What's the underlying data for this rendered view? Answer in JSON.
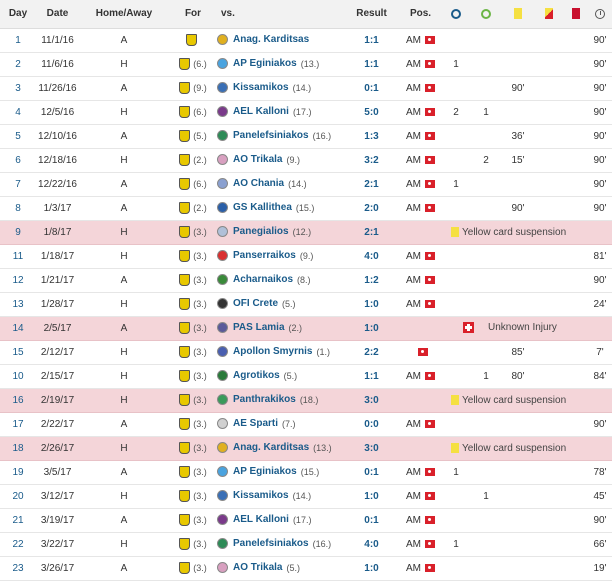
{
  "headers": {
    "day": "Day",
    "date": "Date",
    "home_away": "Home/Away",
    "for": "For",
    "vs": "vs.",
    "result": "Result",
    "pos": "Pos.",
    "goals_icon": "goals-icon",
    "assists_icon": "assists-icon",
    "yellow_icon": "yellow-card-icon",
    "yellowred_icon": "yellow-red-card-icon",
    "red_icon": "red-card-icon",
    "minutes_icon": "minutes-icon"
  },
  "colors": {
    "absent_row": "#f4d5d9",
    "link_blue": "#1a5b8a",
    "flag_red": "#d9202a",
    "card_yellow": "#f5e042"
  },
  "rows": [
    {
      "day": "1",
      "date": "11/1/16",
      "ha": "A",
      "for_pos": "",
      "opp": "Anag. Karditsas",
      "opp_pos": "",
      "result": "1:1",
      "pos": "AM",
      "goals": "",
      "assists": "",
      "yellow": "",
      "yellowred": "",
      "red": "",
      "mins": "90'",
      "crest": "#e0b020"
    },
    {
      "day": "2",
      "date": "11/6/16",
      "ha": "H",
      "for_pos": "(6.)",
      "opp": "AP Eginiakos",
      "opp_pos": "(13.)",
      "result": "1:1",
      "pos": "AM",
      "goals": "1",
      "assists": "",
      "yellow": "",
      "yellowred": "",
      "red": "",
      "mins": "90'",
      "crest": "#4aa3df"
    },
    {
      "day": "3",
      "date": "11/26/16",
      "ha": "A",
      "for_pos": "(9.)",
      "opp": "Kissamikos",
      "opp_pos": "(14.)",
      "result": "0:1",
      "pos": "AM",
      "goals": "",
      "assists": "",
      "yellow": "90'",
      "yellowred": "",
      "red": "",
      "mins": "90'",
      "crest": "#3a6fb5"
    },
    {
      "day": "4",
      "date": "12/5/16",
      "ha": "H",
      "for_pos": "(6.)",
      "opp": "AEL Kalloni",
      "opp_pos": "(17.)",
      "result": "5:0",
      "pos": "AM",
      "goals": "2",
      "assists": "1",
      "yellow": "",
      "yellowred": "",
      "red": "",
      "mins": "90'",
      "crest": "#7a3a8a"
    },
    {
      "day": "5",
      "date": "12/10/16",
      "ha": "A",
      "for_pos": "(5.)",
      "opp": "Panelefsiniakos",
      "opp_pos": "(16.)",
      "result": "1:3",
      "pos": "AM",
      "goals": "",
      "assists": "",
      "yellow": "36'",
      "yellowred": "",
      "red": "",
      "mins": "90'",
      "crest": "#2e8b57"
    },
    {
      "day": "6",
      "date": "12/18/16",
      "ha": "H",
      "for_pos": "(2.)",
      "opp": "AO Trikala",
      "opp_pos": "(9.)",
      "result": "3:2",
      "pos": "AM",
      "goals": "",
      "assists": "2",
      "yellow": "15'",
      "yellowred": "",
      "red": "",
      "mins": "90'",
      "crest": "#d8a0c0"
    },
    {
      "day": "7",
      "date": "12/22/16",
      "ha": "A",
      "for_pos": "(6.)",
      "opp": "AO Chania",
      "opp_pos": "(14.)",
      "result": "2:1",
      "pos": "AM",
      "goals": "1",
      "assists": "",
      "yellow": "",
      "yellowred": "",
      "red": "",
      "mins": "90'",
      "crest": "#8aa0d0"
    },
    {
      "day": "8",
      "date": "1/3/17",
      "ha": "A",
      "for_pos": "(2.)",
      "opp": "GS Kallithea",
      "opp_pos": "(15.)",
      "result": "2:0",
      "pos": "AM",
      "goals": "",
      "assists": "",
      "yellow": "90'",
      "yellowred": "",
      "red": "",
      "mins": "90'",
      "crest": "#2a5fa8"
    },
    {
      "day": "9",
      "date": "1/8/17",
      "ha": "H",
      "for_pos": "(3.)",
      "opp": "Panegialios",
      "opp_pos": "(12.)",
      "result": "2:1",
      "absent": "yellow",
      "note": "Yellow card suspension",
      "crest": "#b0c0d8"
    },
    {
      "day": "11",
      "date": "1/18/17",
      "ha": "H",
      "for_pos": "(3.)",
      "opp": "Panserraikos",
      "opp_pos": "(9.)",
      "result": "4:0",
      "pos": "AM",
      "goals": "",
      "assists": "",
      "yellow": "",
      "yellowred": "",
      "red": "",
      "mins": "81'",
      "crest": "#d93030"
    },
    {
      "day": "12",
      "date": "1/21/17",
      "ha": "A",
      "for_pos": "(3.)",
      "opp": "Acharnaikos",
      "opp_pos": "(8.)",
      "result": "1:2",
      "pos": "AM",
      "goals": "",
      "assists": "",
      "yellow": "",
      "yellowred": "",
      "red": "",
      "mins": "90'",
      "crest": "#3a8a3a"
    },
    {
      "day": "13",
      "date": "1/28/17",
      "ha": "H",
      "for_pos": "(3.)",
      "opp": "OFI Crete",
      "opp_pos": "(5.)",
      "result": "1:0",
      "pos": "AM",
      "goals": "",
      "assists": "",
      "yellow": "",
      "yellowred": "",
      "red": "",
      "mins": "24'",
      "crest": "#333333"
    },
    {
      "day": "14",
      "date": "2/5/17",
      "ha": "A",
      "for_pos": "(3.)",
      "opp": "PAS Lamia",
      "opp_pos": "(2.)",
      "result": "1:0",
      "absent": "injury",
      "note": "Unknown Injury",
      "crest": "#5a5a9a"
    },
    {
      "day": "15",
      "date": "2/12/17",
      "ha": "H",
      "for_pos": "(3.)",
      "opp": "Apollon Smyrnis",
      "opp_pos": "(1.)",
      "result": "2:2",
      "pos": "",
      "goals": "",
      "assists": "",
      "yellow": "85'",
      "yellowred": "",
      "red": "",
      "mins": "7'",
      "crest": "#4a5fb0"
    },
    {
      "day": "10",
      "date": "2/15/17",
      "ha": "H",
      "for_pos": "(3.)",
      "opp": "Agrotikos",
      "opp_pos": "(5.)",
      "result": "1:1",
      "pos": "AM",
      "goals": "",
      "assists": "1",
      "yellow": "80'",
      "yellowred": "",
      "red": "",
      "mins": "84'",
      "crest": "#2a7a3a"
    },
    {
      "day": "16",
      "date": "2/19/17",
      "ha": "H",
      "for_pos": "(3.)",
      "opp": "Panthrakikos",
      "opp_pos": "(18.)",
      "result": "3:0",
      "absent": "yellow",
      "note": "Yellow card suspension",
      "crest": "#3a9a5a"
    },
    {
      "day": "17",
      "date": "2/22/17",
      "ha": "A",
      "for_pos": "(3.)",
      "opp": "AE Sparti",
      "opp_pos": "(7.)",
      "result": "0:0",
      "pos": "AM",
      "goals": "",
      "assists": "",
      "yellow": "",
      "yellowred": "",
      "red": "",
      "mins": "90'",
      "crest": "#d0d0d0"
    },
    {
      "day": "18",
      "date": "2/26/17",
      "ha": "H",
      "for_pos": "(3.)",
      "opp": "Anag. Karditsas",
      "opp_pos": "(13.)",
      "result": "3:0",
      "absent": "yellow",
      "note": "Yellow card suspension",
      "crest": "#e0b020"
    },
    {
      "day": "19",
      "date": "3/5/17",
      "ha": "A",
      "for_pos": "(3.)",
      "opp": "AP Eginiakos",
      "opp_pos": "(15.)",
      "result": "0:1",
      "pos": "AM",
      "goals": "1",
      "assists": "",
      "yellow": "",
      "yellowred": "",
      "red": "",
      "mins": "78'",
      "crest": "#4aa3df"
    },
    {
      "day": "20",
      "date": "3/12/17",
      "ha": "H",
      "for_pos": "(3.)",
      "opp": "Kissamikos",
      "opp_pos": "(14.)",
      "result": "1:0",
      "pos": "AM",
      "goals": "",
      "assists": "1",
      "yellow": "",
      "yellowred": "",
      "red": "",
      "mins": "45'",
      "crest": "#3a6fb5"
    },
    {
      "day": "21",
      "date": "3/19/17",
      "ha": "A",
      "for_pos": "(3.)",
      "opp": "AEL Kalloni",
      "opp_pos": "(17.)",
      "result": "0:1",
      "pos": "AM",
      "goals": "",
      "assists": "",
      "yellow": "",
      "yellowred": "",
      "red": "",
      "mins": "90'",
      "crest": "#7a3a8a"
    },
    {
      "day": "22",
      "date": "3/22/17",
      "ha": "H",
      "for_pos": "(3.)",
      "opp": "Panelefsiniakos",
      "opp_pos": "(16.)",
      "result": "4:0",
      "pos": "AM",
      "goals": "1",
      "assists": "",
      "yellow": "",
      "yellowred": "",
      "red": "",
      "mins": "66'",
      "crest": "#2e8b57"
    },
    {
      "day": "23",
      "date": "3/26/17",
      "ha": "A",
      "for_pos": "(3.)",
      "opp": "AO Trikala",
      "opp_pos": "(5.)",
      "result": "1:0",
      "pos": "AM",
      "goals": "",
      "assists": "",
      "yellow": "",
      "yellowred": "",
      "red": "",
      "mins": "19'",
      "crest": "#d8a0c0"
    }
  ]
}
